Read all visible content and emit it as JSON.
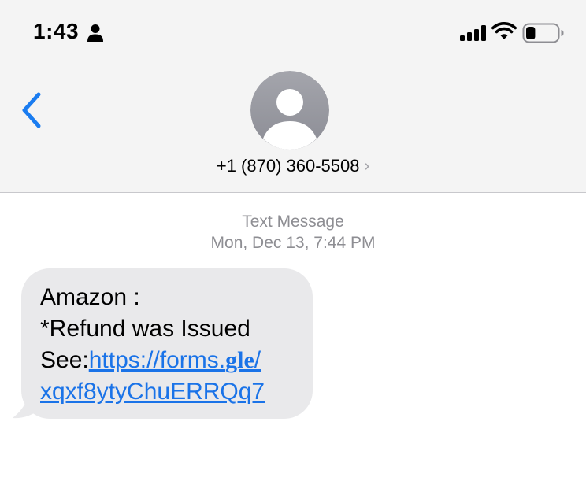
{
  "status_bar": {
    "time": "1:43",
    "battery_level": 0.3
  },
  "nav": {
    "contact_number": "+1 (870) 360-5508",
    "chevron": "›"
  },
  "thread": {
    "message_type": "Text Message",
    "timestamp": "Mon, Dec 13, 7:44 PM"
  },
  "message": {
    "line1": "Amazon :",
    "line2": "*Refund was Issued",
    "line3_prefix": "See:",
    "link_part1": "https://forms.",
    "link_part2": "gle",
    "link_part3": "/",
    "link_line2": "xqxf8ytyChuERRQq7"
  },
  "colors": {
    "accent": "#1a73e8",
    "back_chevron": "#1a7cf0",
    "bubble": "#e9e9eb",
    "header_bg": "#f4f4f4",
    "avatar": "#9a9aa2"
  },
  "icons": {
    "back": "chevron-left-icon",
    "person": "person-icon",
    "signal": "cellular-signal-icon",
    "wifi": "wifi-icon",
    "battery": "battery-icon",
    "avatar": "contact-avatar-icon"
  }
}
